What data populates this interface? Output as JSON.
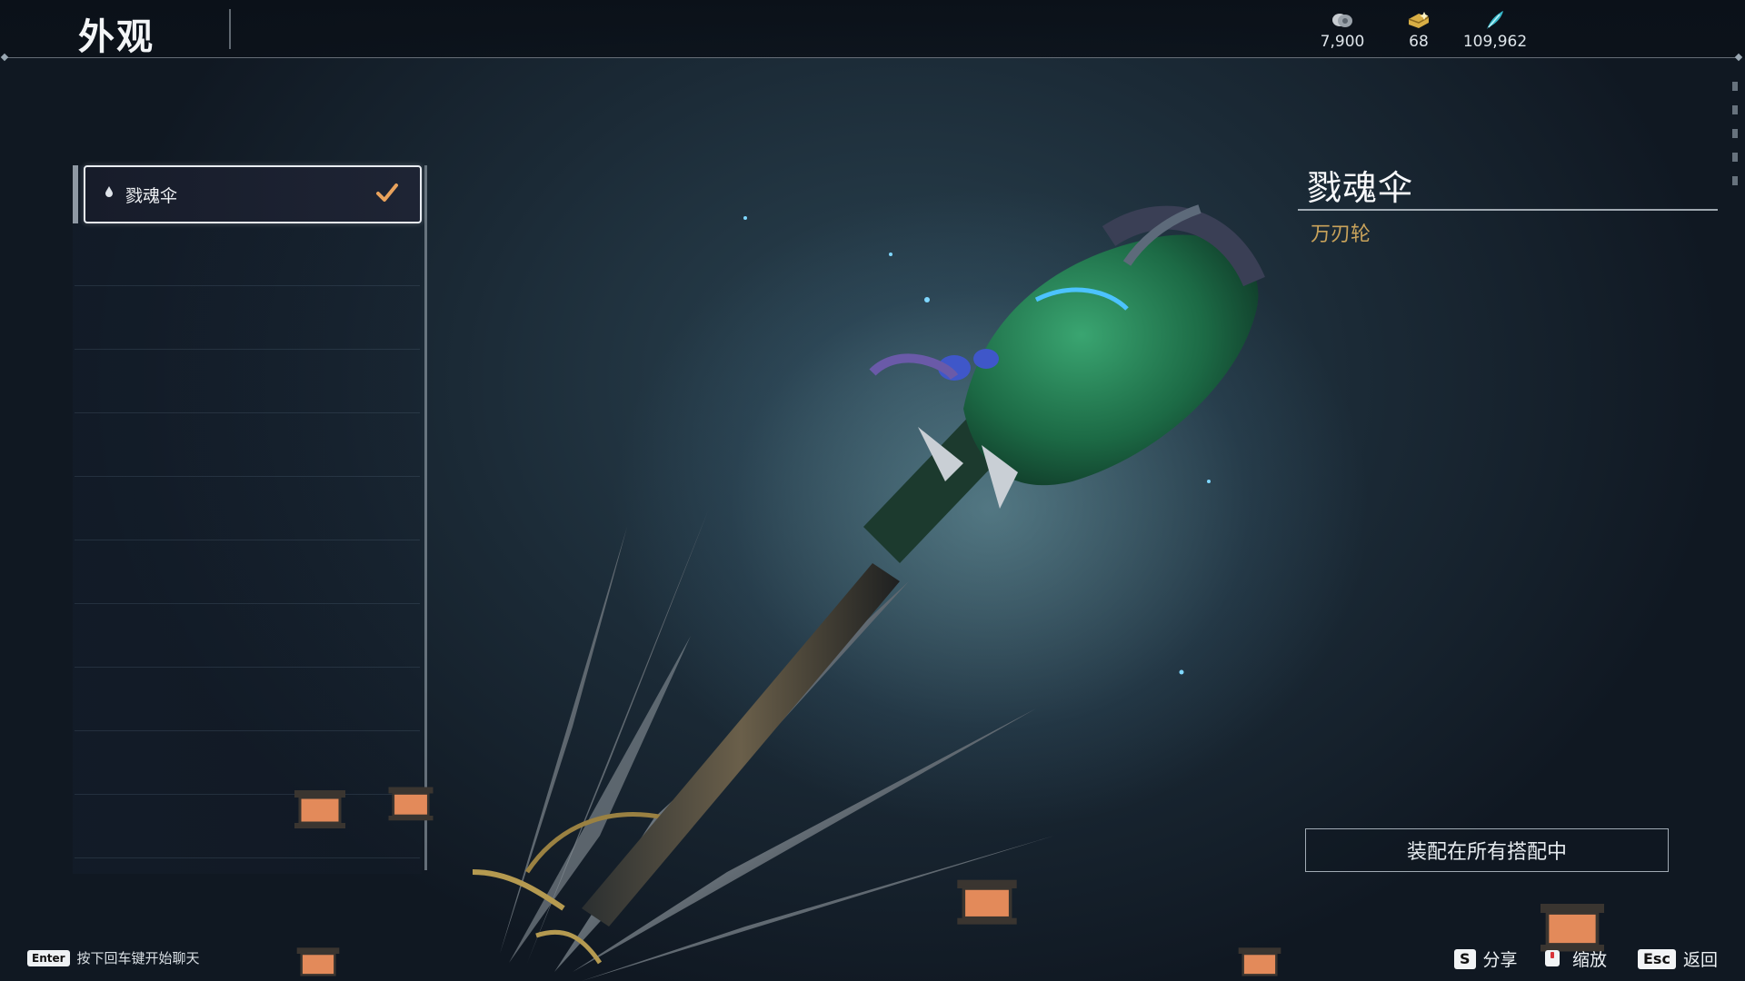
{
  "header": {
    "title": "外观"
  },
  "currencies": [
    {
      "icon": "coin-stack-icon",
      "value": "7,900"
    },
    {
      "icon": "gold-ingot-icon",
      "value": "68"
    },
    {
      "icon": "feather-crystal-icon",
      "value": "109,962"
    }
  ],
  "list": {
    "items": [
      {
        "label": "戮魂伞",
        "equipped": true
      }
    ]
  },
  "detail": {
    "name": "戮魂伞",
    "category": "万刃轮",
    "equip_status": "装配在所有搭配中"
  },
  "footer": {
    "chat_key": "Enter",
    "chat_hint": "按下回车键开始聊天",
    "share_key": "S",
    "share_label": "分享",
    "zoom_label": "缩放",
    "back_key": "Esc",
    "back_label": "返回"
  },
  "colors": {
    "accent_gold": "#c9a35b",
    "check_orange": "#e9a25c"
  }
}
